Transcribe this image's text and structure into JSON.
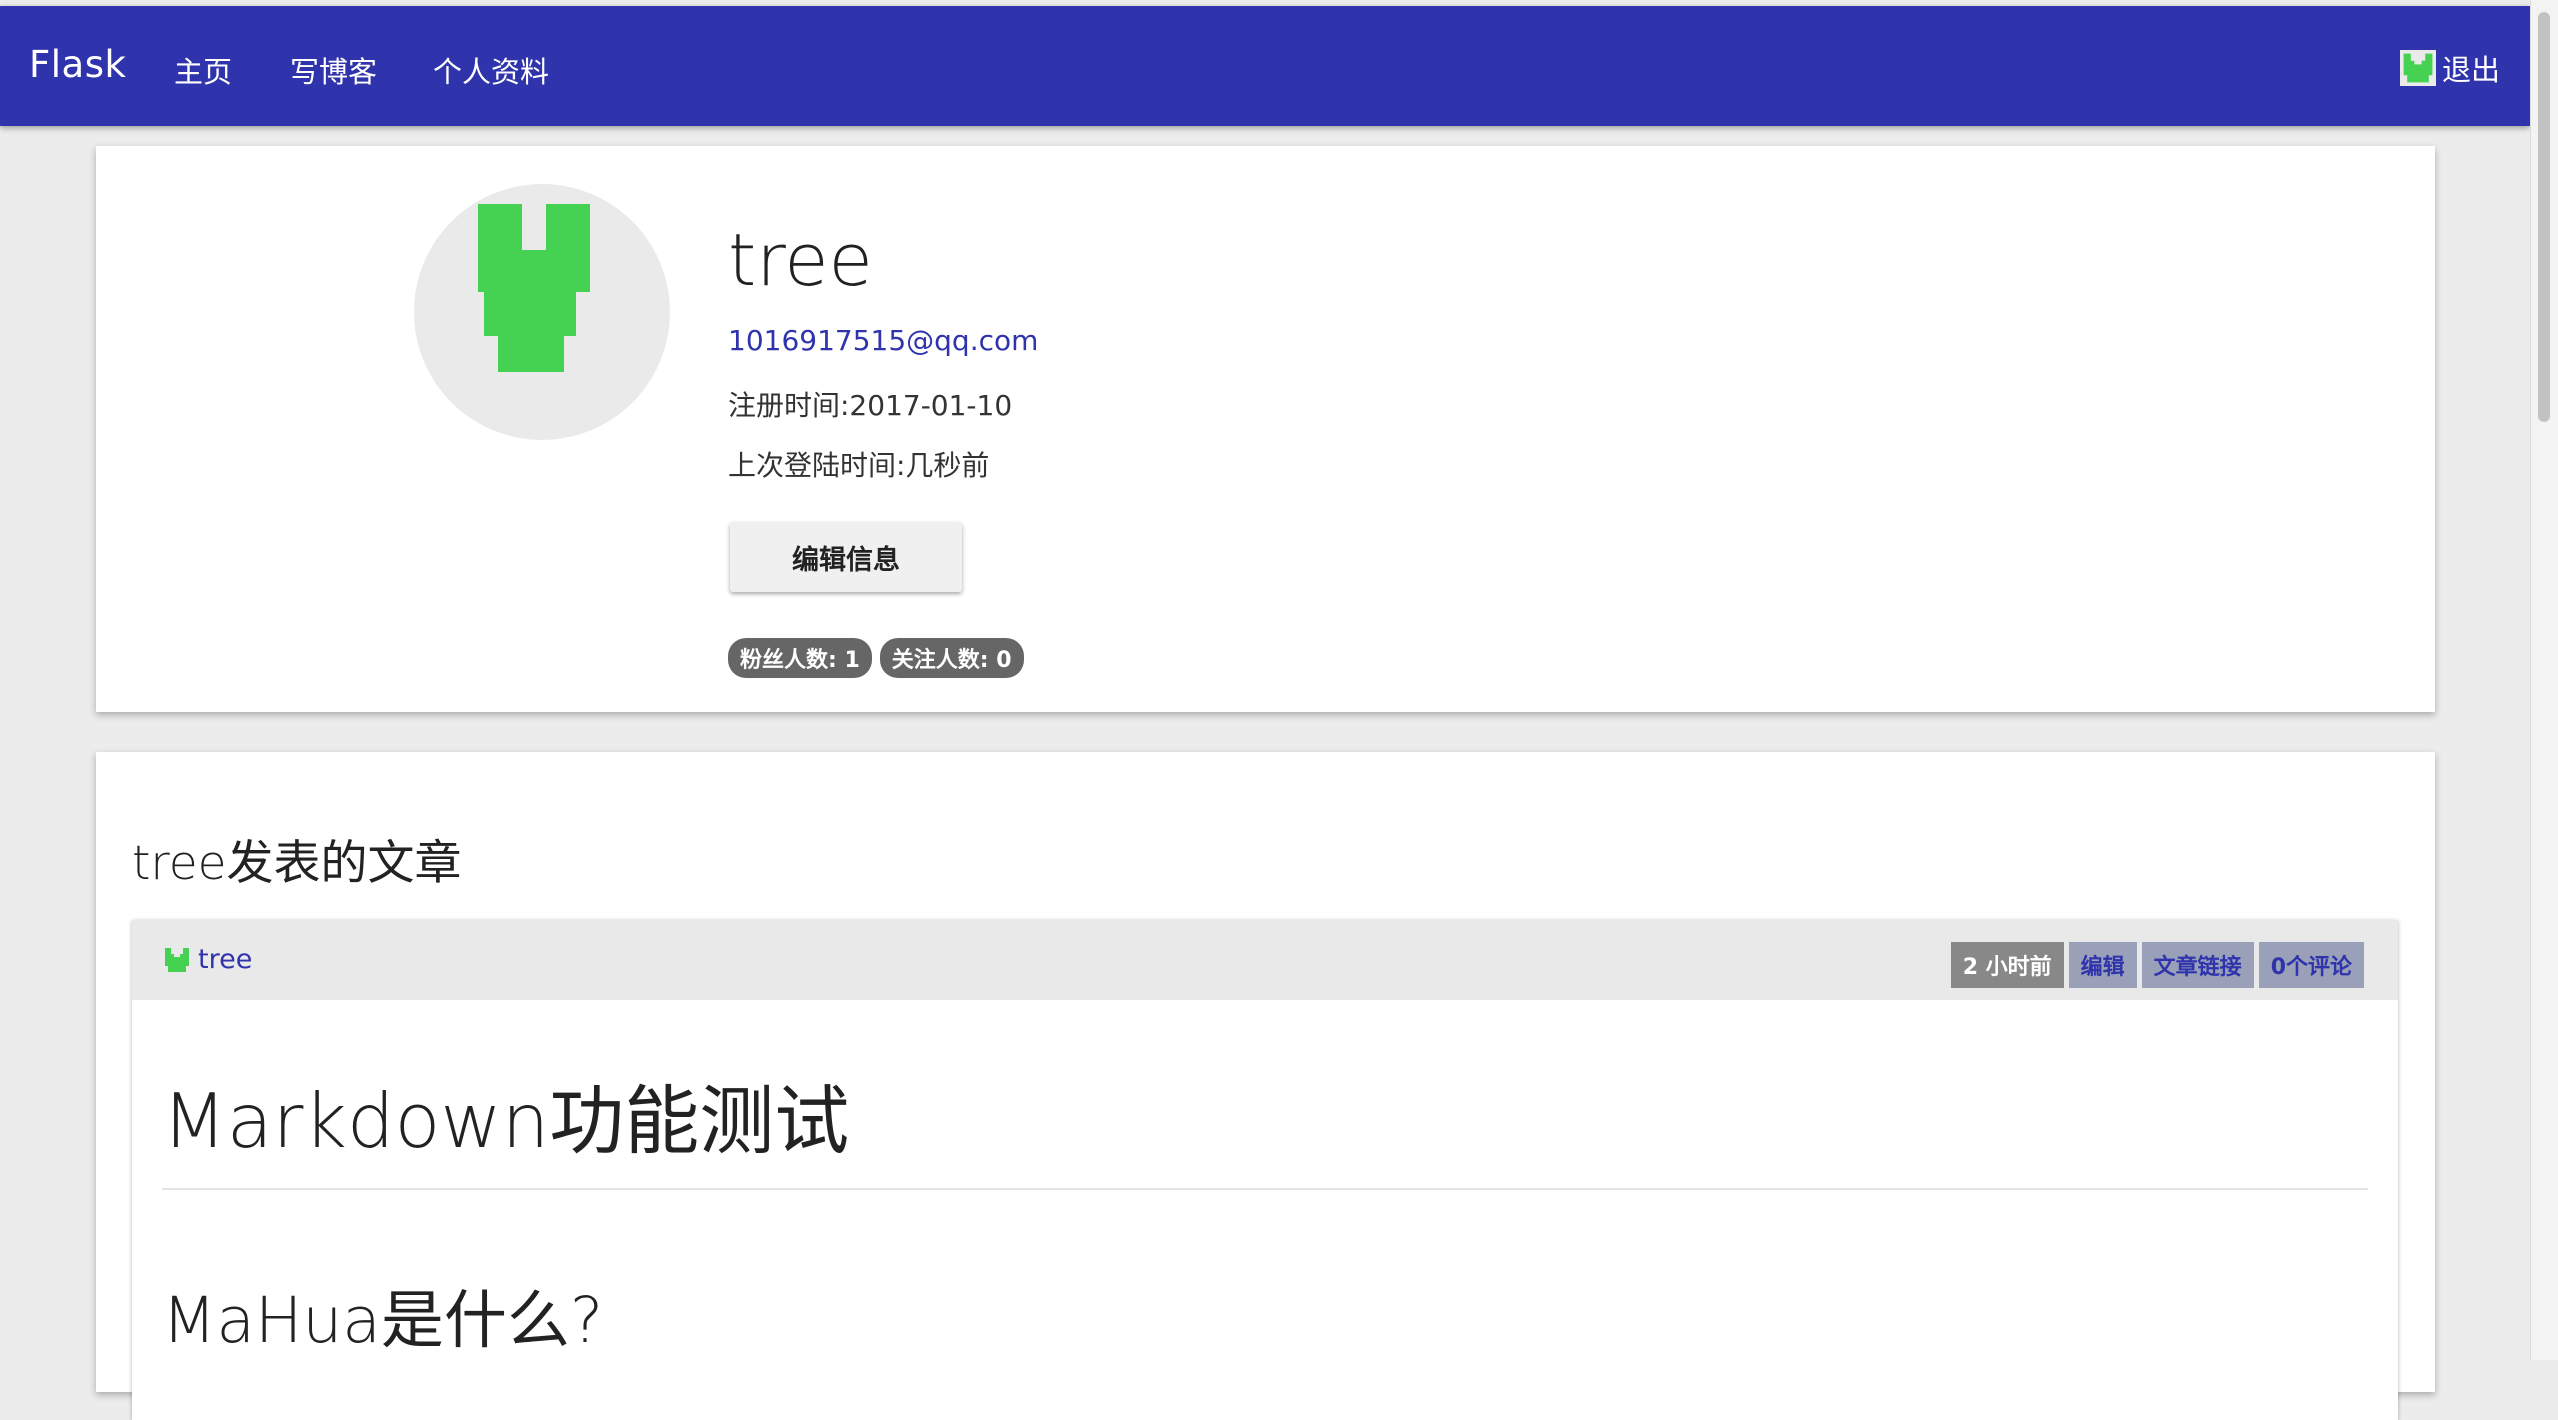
{
  "navbar": {
    "brand": "Flask",
    "links": [
      "主页",
      "写博客",
      "个人资料"
    ],
    "logout_label": "退出",
    "bg_color": "#3034ac"
  },
  "profile": {
    "username": "tree",
    "email": "1016917515@qq.com",
    "registered": "注册时间:2017-01-10",
    "last_seen": "上次登陆时间:几秒前",
    "edit_button": "编辑信息",
    "followers_badge": "粉丝人数: 1",
    "following_badge": "关注人数: 0",
    "avatar_icon": "identicon-avatar",
    "avatar_color": "#45d151"
  },
  "posts": {
    "heading": "tree发表的文章",
    "items": [
      {
        "author": "tree",
        "time_label": "2 小时前",
        "edit_label": "编辑",
        "link_label": "文章链接",
        "comments_label": "0个评论",
        "title": "Markdown功能测试",
        "subtitle": "MaHua是什么?"
      }
    ]
  }
}
